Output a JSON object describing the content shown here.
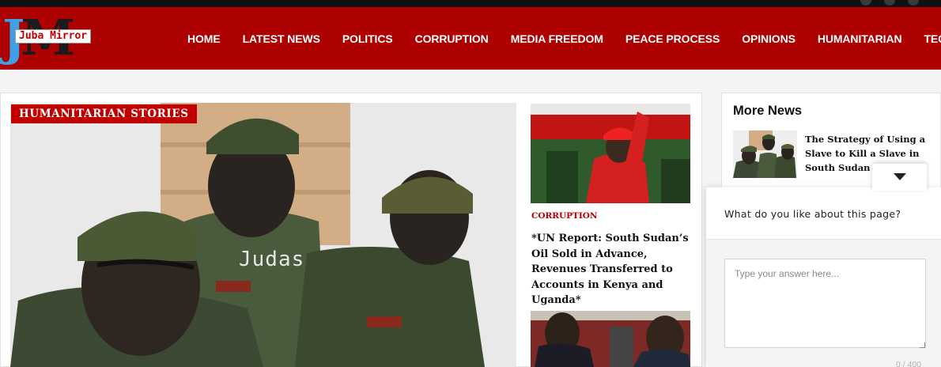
{
  "site": {
    "logo_letters_j": "J",
    "logo_letters_m": "M",
    "logo_tag": "Juba Mirror",
    "brand_color": "#ad0000",
    "accent_color": "#c00000"
  },
  "nav": {
    "items": [
      "HOME",
      "LATEST NEWS",
      "POLITICS",
      "CORRUPTION",
      "MEDIA FREEDOM",
      "PEACE PROCESS",
      "OPINIONS",
      "HUMANITARIAN",
      "TECH"
    ]
  },
  "hero": {
    "badge": "HUMANITARIAN STORIES",
    "overlay_text": "Judas"
  },
  "side_stories": [
    {
      "category": "CORRUPTION",
      "title": "*UN Report: South Sudan’s Oil Sold in Advance, Revenues Transferred to Accounts in Kenya and Uganda*"
    }
  ],
  "more_news": {
    "title": "More News",
    "items": [
      {
        "title": "The Strategy of Using a Slave to Kill a Slave in South Sudan"
      }
    ]
  },
  "feedback": {
    "toggle_icon": "chevron-down-icon",
    "question": "What do you like about this page?",
    "placeholder": "Type your answer here...",
    "value": "",
    "counter": "0 / 400"
  }
}
